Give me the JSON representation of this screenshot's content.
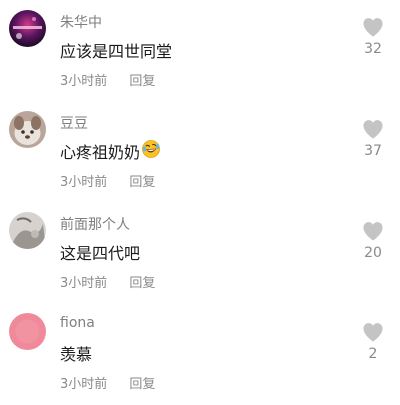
{
  "comments": [
    {
      "username": "朱华中",
      "content": "应该是四世同堂",
      "time": "3小时前",
      "reply_label": "回复",
      "likes": "32",
      "avatar": "stage-photo-avatar"
    },
    {
      "username": "豆豆",
      "content": "心疼祖奶奶",
      "time": "3小时前",
      "reply_label": "回复",
      "likes": "37",
      "avatar": "dog-photo-avatar",
      "emoji": "rolling-laughing-emoji"
    },
    {
      "username": "前面那个人",
      "content": "这是四代吧",
      "time": "3小时前",
      "reply_label": "回复",
      "likes": "20",
      "avatar": "sketch-photo-avatar"
    },
    {
      "username": "fiona",
      "content": "羡慕",
      "time": "3小时前",
      "reply_label": "回复",
      "likes": "2",
      "avatar": "pink-circle-avatar"
    }
  ],
  "colors": {
    "username": "#7f7f7f",
    "content": "#1a1a1a",
    "meta": "#8a8a8a",
    "heart": "#c4c4c4",
    "background": "#ffffff"
  },
  "icons": {
    "like": "heart-icon"
  }
}
